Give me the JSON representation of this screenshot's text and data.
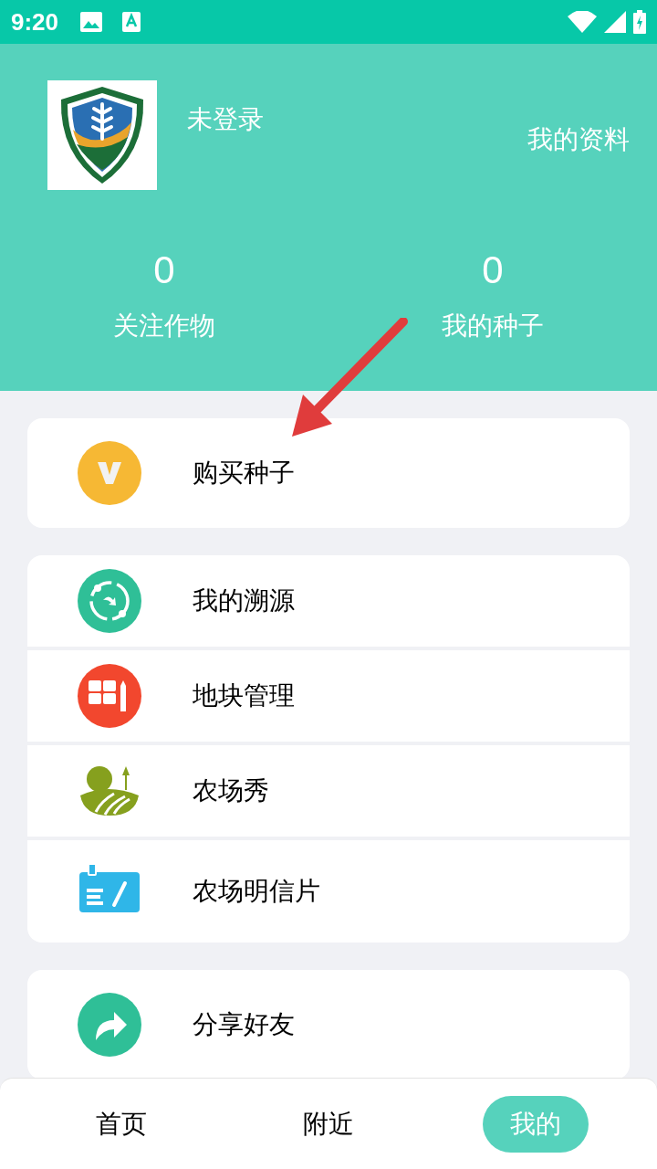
{
  "status_bar": {
    "time": "9:20"
  },
  "profile": {
    "name": "未登录",
    "link": "我的资料"
  },
  "stats": [
    {
      "value": "0",
      "label": "关注作物"
    },
    {
      "value": "0",
      "label": "我的种子"
    }
  ],
  "menu_groups": [
    {
      "items": [
        {
          "kind": "vip",
          "label": "购买种子"
        }
      ]
    },
    {
      "items": [
        {
          "kind": "trace",
          "label": "我的溯源"
        },
        {
          "kind": "plot",
          "label": "地块管理"
        },
        {
          "kind": "farm",
          "label": "农场秀"
        },
        {
          "kind": "card",
          "label": "农场明信片"
        }
      ]
    },
    {
      "items": [
        {
          "kind": "share",
          "label": "分享好友"
        }
      ]
    }
  ],
  "tabs": [
    {
      "label": "首页",
      "selected": false
    },
    {
      "label": "附近",
      "selected": false
    },
    {
      "label": "我的",
      "selected": true
    }
  ]
}
